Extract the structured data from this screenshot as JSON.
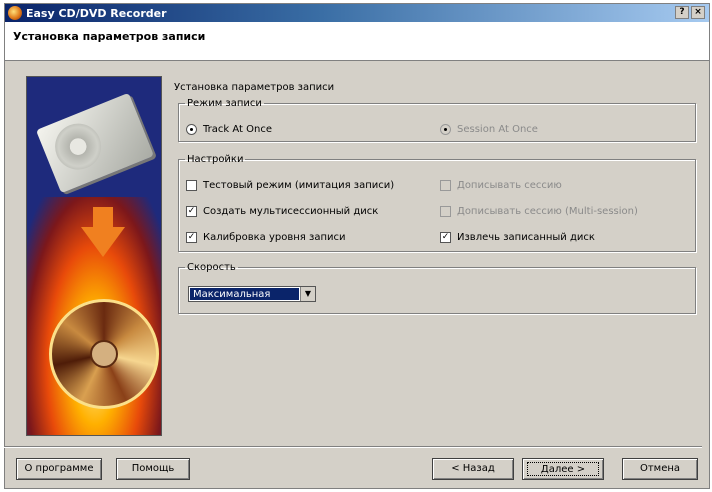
{
  "window": {
    "title": "Easy CD/DVD Recorder",
    "help_btn": "?",
    "close_btn": "×"
  },
  "header": {
    "title": "Установка параметров записи"
  },
  "content": {
    "title": "Установка параметров записи"
  },
  "mode": {
    "legend": "Режим записи",
    "options": [
      {
        "label": "Track At Once",
        "selected": true,
        "enabled": true
      },
      {
        "label": "Session At Once",
        "selected": false,
        "enabled": false
      }
    ]
  },
  "settings": {
    "legend": "Настройки",
    "options": [
      {
        "label": "Тестовый режим (имитация записи)",
        "checked": false,
        "enabled": true
      },
      {
        "label": "Создать мультисессионный диск",
        "checked": true,
        "enabled": true
      },
      {
        "label": "Калибровка уровня записи",
        "checked": true,
        "enabled": true
      },
      {
        "label": "Дописывать сессию",
        "checked": false,
        "enabled": false
      },
      {
        "label": "Дописывать сессию (Multi-session)",
        "checked": false,
        "enabled": false
      },
      {
        "label": "Извлечь записанный диск",
        "checked": true,
        "enabled": true
      }
    ]
  },
  "speed": {
    "legend": "Скорость",
    "selected": "Максимальная"
  },
  "buttons": {
    "about": "О программе",
    "help": "Помощь",
    "back": "< Назад",
    "next": "Далее >",
    "cancel": "Отмена"
  },
  "colors": {
    "titlebar_start": "#0a246a",
    "titlebar_end": "#a6caf0",
    "dialog_bg": "#d4d0c8",
    "side_panel_bg": "#1e2a7c"
  },
  "icons": {
    "app": "flaming-disc-icon",
    "dropdown": "chevron-down-icon",
    "side_art": [
      "hard-drive-icon",
      "down-arrow-icon",
      "flame-icon",
      "disc-icon"
    ]
  }
}
